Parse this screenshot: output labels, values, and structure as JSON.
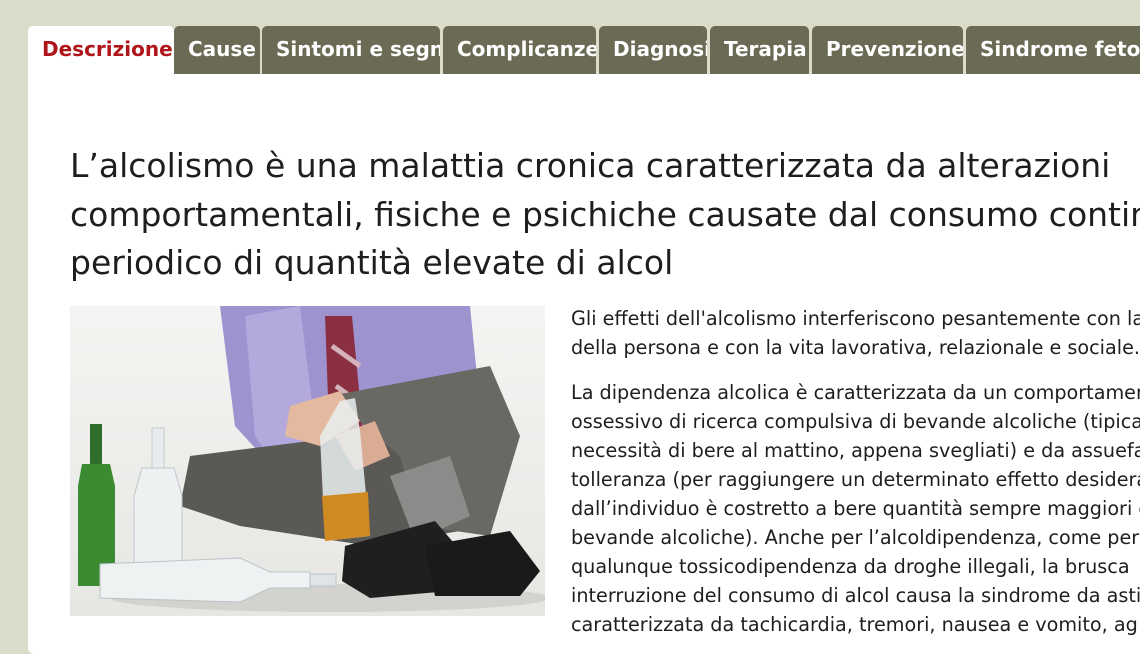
{
  "tabs": [
    {
      "label": "Descrizione",
      "active": true
    },
    {
      "label": "Cause",
      "active": false
    },
    {
      "label": "Sintomi e segni",
      "active": false
    },
    {
      "label": "Complicanze",
      "active": false
    },
    {
      "label": "Diagnosi",
      "active": false
    },
    {
      "label": "Terapia",
      "active": false
    },
    {
      "label": "Prevenzione",
      "active": false
    },
    {
      "label": "Sindrome feto-a",
      "active": false
    }
  ],
  "article": {
    "title_lines": [
      "L’alcolismo è una malattia cronica caratterizzata da alterazioni",
      "comportamentali, fisiche e psichiche causate dal consumo continuati",
      "periodico di quantità elevate di alcol"
    ],
    "paragraph_1_lines": [
      "Gli effetti dell'alcolismo interferiscono pesantemente con la",
      "della persona e con la vita lavorativa, relazionale e sociale."
    ],
    "paragraph_2_lines": [
      "La dipendenza alcolica è caratterizzata da un comportamen",
      "ossessivo di ricerca compulsiva di bevande alcoliche (tipica",
      "necessità di bere al mattino, appena svegliati) e da assuefaz",
      "tolleranza (per raggiungere un determinato effetto desidera",
      "dall’individuo è costretto a bere quantità sempre maggiori c",
      "bevande alcoliche). Anche per l’alcoldipendenza, come per",
      "qualunque tossicodipendenza da droghe illegali, la brusca",
      "interruzione del consumo di alcol causa la sindrome da astin",
      "caratterizzata da tachicardia, tremori, nausea e vomito, ag"
    ]
  },
  "colors": {
    "tab_background": "#6b6b55",
    "active_tab_text": "#b0151c",
    "page_background": "#dcdccb"
  }
}
